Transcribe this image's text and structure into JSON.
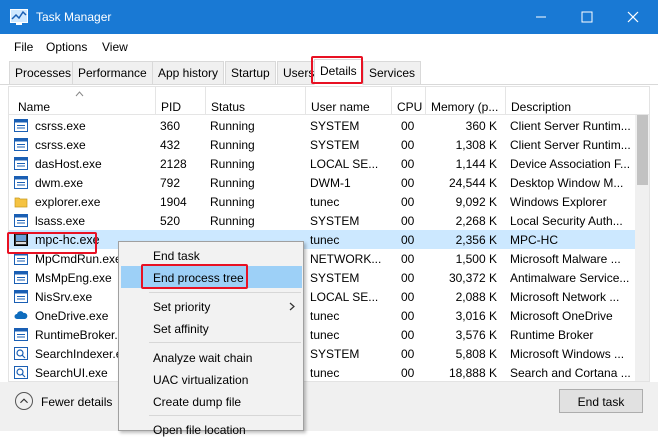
{
  "window": {
    "title": "Task Manager"
  },
  "menubar": {
    "items": [
      "File",
      "Options",
      "View"
    ]
  },
  "tabs": [
    "Processes",
    "Performance",
    "App history",
    "Startup",
    "Users",
    "Details",
    "Services"
  ],
  "columns": [
    "Name",
    "PID",
    "Status",
    "User name",
    "CPU",
    "Memory (p...",
    "Description"
  ],
  "processes": [
    {
      "name": "csrss.exe",
      "pid": "360",
      "status": "Running",
      "user": "SYSTEM",
      "cpu": "00",
      "mem": "360 K",
      "desc": "Client Server Runtim..."
    },
    {
      "name": "csrss.exe",
      "pid": "432",
      "status": "Running",
      "user": "SYSTEM",
      "cpu": "00",
      "mem": "1,308 K",
      "desc": "Client Server Runtim..."
    },
    {
      "name": "dasHost.exe",
      "pid": "2128",
      "status": "Running",
      "user": "LOCAL SE...",
      "cpu": "00",
      "mem": "1,144 K",
      "desc": "Device Association F..."
    },
    {
      "name": "dwm.exe",
      "pid": "792",
      "status": "Running",
      "user": "DWM-1",
      "cpu": "00",
      "mem": "24,544 K",
      "desc": "Desktop Window M..."
    },
    {
      "name": "explorer.exe",
      "pid": "1904",
      "status": "Running",
      "user": "tunec",
      "cpu": "00",
      "mem": "9,092 K",
      "desc": "Windows Explorer"
    },
    {
      "name": "lsass.exe",
      "pid": "520",
      "status": "Running",
      "user": "SYSTEM",
      "cpu": "00",
      "mem": "2,268 K",
      "desc": "Local Security Auth..."
    },
    {
      "name": "mpc-hc.exe",
      "pid": "",
      "status": "",
      "user": "tunec",
      "cpu": "00",
      "mem": "2,356 K",
      "desc": "MPC-HC"
    },
    {
      "name": "MpCmdRun.exe",
      "pid": "",
      "status": "",
      "user": "NETWORK...",
      "cpu": "00",
      "mem": "1,500 K",
      "desc": "Microsoft Malware ..."
    },
    {
      "name": "MsMpEng.exe",
      "pid": "",
      "status": "",
      "user": "SYSTEM",
      "cpu": "00",
      "mem": "30,372 K",
      "desc": "Antimalware Service..."
    },
    {
      "name": "NisSrv.exe",
      "pid": "",
      "status": "",
      "user": "LOCAL SE...",
      "cpu": "00",
      "mem": "2,088 K",
      "desc": "Microsoft Network ..."
    },
    {
      "name": "OneDrive.exe",
      "pid": "",
      "status": "",
      "user": "tunec",
      "cpu": "00",
      "mem": "3,016 K",
      "desc": "Microsoft OneDrive"
    },
    {
      "name": "RuntimeBroker.exe",
      "pid": "",
      "status": "",
      "user": "tunec",
      "cpu": "00",
      "mem": "3,576 K",
      "desc": "Runtime Broker"
    },
    {
      "name": "SearchIndexer.exe",
      "pid": "",
      "status": "",
      "user": "SYSTEM",
      "cpu": "00",
      "mem": "5,808 K",
      "desc": "Microsoft Windows ..."
    },
    {
      "name": "SearchUI.exe",
      "pid": "",
      "status": "",
      "user": "tunec",
      "cpu": "00",
      "mem": "18,888 K",
      "desc": "Search and Cortana ..."
    }
  ],
  "context_menu": {
    "items": [
      "End task",
      "End process tree",
      "Set priority",
      "Set affinity",
      "Analyze wait chain",
      "UAC virtualization",
      "Create dump file",
      "Open file location"
    ]
  },
  "footer": {
    "fewer_details": "Fewer details",
    "end_task": "End task"
  },
  "colors": {
    "titlebar": "#1979d4",
    "selection": "#cce8ff",
    "menu_hover": "#9dd0f7",
    "highlight_box": "#e81123"
  }
}
